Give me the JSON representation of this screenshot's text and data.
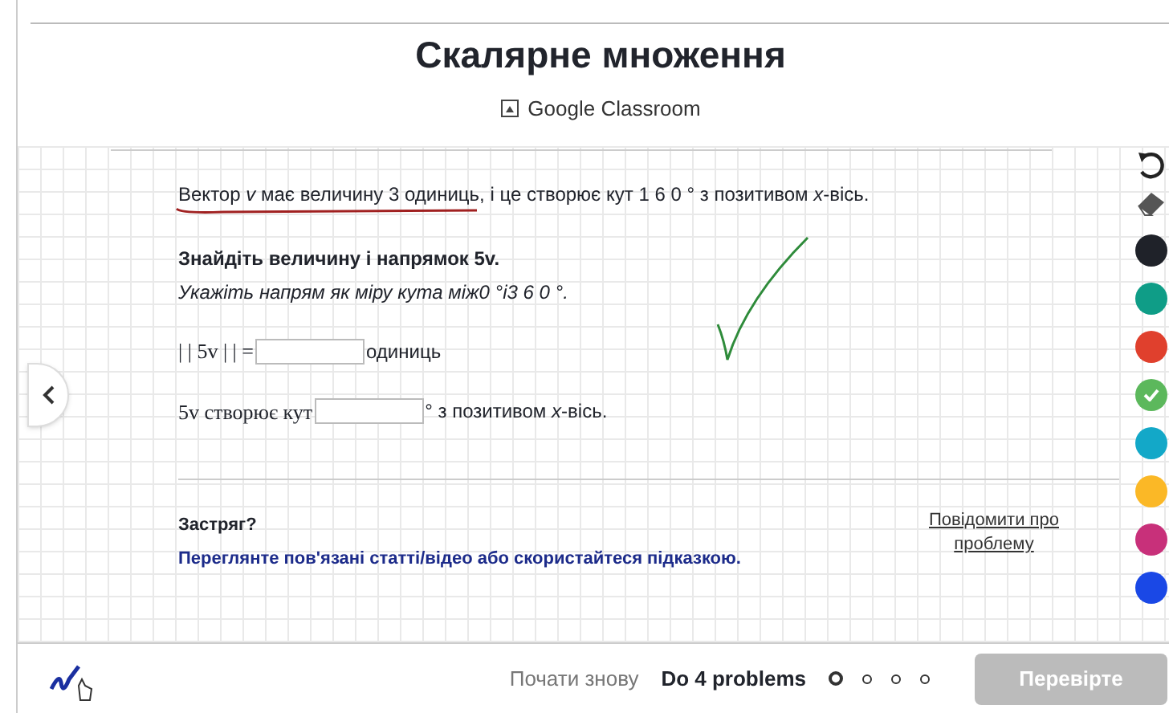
{
  "header": {
    "title": "Скалярне множення",
    "classroom_link": "Google Classroom"
  },
  "problem": {
    "statement": "Вектор *v* має величину 3 одиниць, і це створює кут 1 6 0 ° з позитивом *x*-вісь.",
    "task_title": "Знайдіть величину і напрямок 5v.",
    "task_hint": "Укажіть напрям як міру кута між0 °і3 6 0 °.",
    "answers": [
      {
        "before": "| | 5v | | =",
        "after": "одиниць"
      },
      {
        "before": "5v створює кут",
        "after": "° з позитивом *x*-вісь."
      }
    ]
  },
  "help": {
    "title": "Застряг?",
    "link": "Переглянте пов'язані статті/відео або скористайтеся підказкою.",
    "report_link": "Повідомити про проблему"
  },
  "pen_colors": [
    {
      "color": "#1f2229",
      "selected": false
    },
    {
      "color": "#0f9d87",
      "selected": false
    },
    {
      "color": "#e0402d",
      "selected": false
    },
    {
      "color": "#5cb85c",
      "selected": true
    },
    {
      "color": "#13a8c8",
      "selected": false
    },
    {
      "color": "#fbb826",
      "selected": false
    },
    {
      "color": "#c8307a",
      "selected": false
    },
    {
      "color": "#1a48e6",
      "selected": false
    }
  ],
  "footer": {
    "restart": "Почати знову",
    "progress_label": "Do 4 problems",
    "problems": [
      {
        "selected": true
      },
      {
        "selected": false
      },
      {
        "selected": false
      },
      {
        "selected": false
      }
    ],
    "check_button": "Перевірте",
    "check_disabled": true
  }
}
